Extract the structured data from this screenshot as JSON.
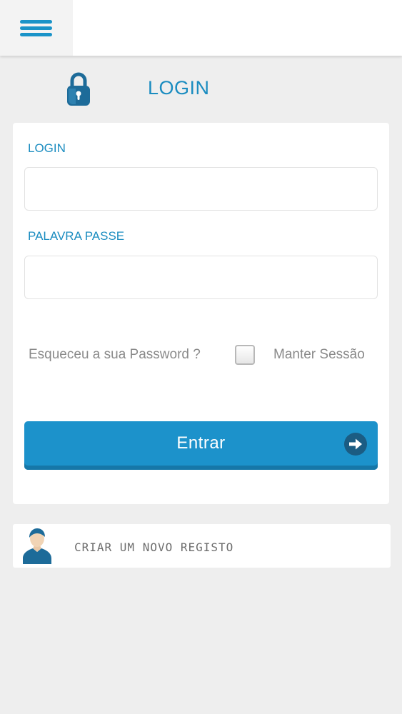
{
  "header": {
    "menu_icon": "hamburger-menu-icon",
    "brand_color": "#1a93c8"
  },
  "page": {
    "title": "LOGIN",
    "icon": "lock-icon"
  },
  "login_form": {
    "login_label": "LOGIN",
    "login_value": "",
    "password_label": "PALAVRA PASSE",
    "password_value": "",
    "forgot_password": "Esqueceu a sua Password ?",
    "keep_session_label": "Manter Sessão",
    "keep_session_checked": false,
    "submit_label": "Entrar",
    "submit_icon": "arrow-right-circle-icon",
    "accent_color": "#1c92cb"
  },
  "register": {
    "label": "CRIAR UM NOVO REGISTO",
    "icon": "user-avatar-icon"
  }
}
